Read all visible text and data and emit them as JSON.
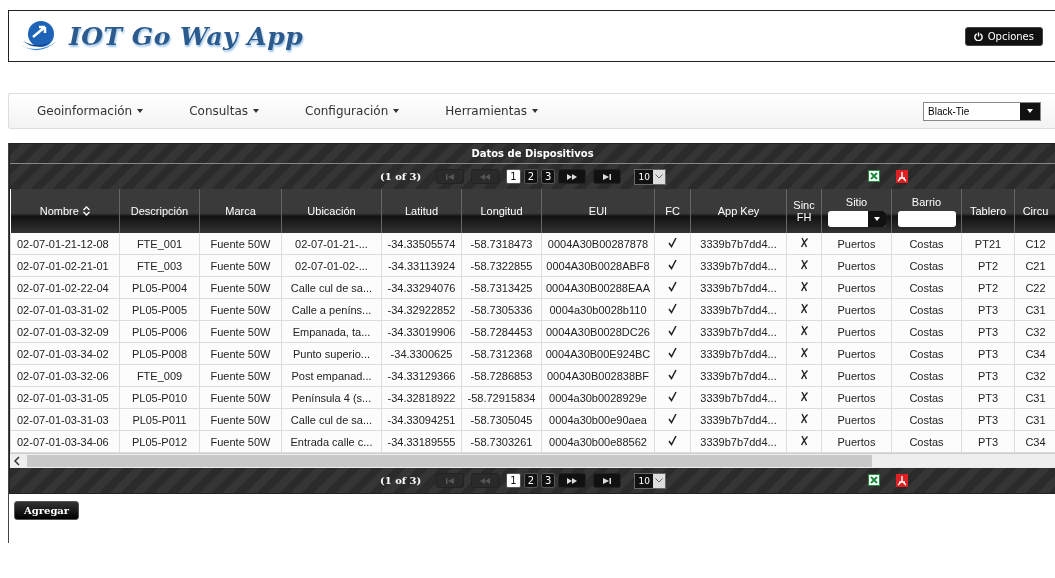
{
  "app": {
    "title": "IOT Go Way App",
    "options_button": "Opciones"
  },
  "menu": [
    {
      "label": "Geoinformación"
    },
    {
      "label": "Consultas"
    },
    {
      "label": "Configuración"
    },
    {
      "label": "Herramientas"
    }
  ],
  "theme_select": {
    "value": "Black-Tie"
  },
  "table": {
    "title": "Datos de Dispositivos",
    "paginators": [
      {
        "status": "(1 of 3)",
        "first": {
          "disabled": true
        },
        "previous": {
          "disabled": true
        },
        "pages": [
          {
            "label": "1",
            "selected": true
          },
          {
            "label": "2",
            "selected": false
          },
          {
            "label": "3",
            "selected": false
          }
        ],
        "next": {
          "disabled": false
        },
        "last": {
          "disabled": false
        },
        "page_size": "10",
        "exports": [
          {
            "kind": "excel"
          },
          {
            "kind": "pdf"
          }
        ]
      },
      {
        "status": "(1 of 3)",
        "first": {
          "disabled": true
        },
        "previous": {
          "disabled": true
        },
        "pages": [
          {
            "label": "1",
            "selected": true
          },
          {
            "label": "2",
            "selected": false
          },
          {
            "label": "3",
            "selected": false
          }
        ],
        "next": {
          "disabled": false
        },
        "last": {
          "disabled": false
        },
        "page_size": "10",
        "exports": [
          {
            "kind": "excel"
          },
          {
            "kind": "pdf"
          }
        ]
      }
    ],
    "columns": [
      {
        "label": "Nombre",
        "sortable": true
      },
      {
        "label": "Descripción"
      },
      {
        "label": "Marca"
      },
      {
        "label": "Ubicación"
      },
      {
        "label": "Latitud"
      },
      {
        "label": "Longitud"
      },
      {
        "label": "EUI"
      },
      {
        "label": "FC"
      },
      {
        "label": "App Key"
      },
      {
        "label": "Sinc FH"
      },
      {
        "label": "Sitio",
        "filter": {
          "kind": "select"
        }
      },
      {
        "label": "Barrio",
        "filter": {
          "kind": "text"
        }
      },
      {
        "label": "Tablero"
      },
      {
        "label": "Circu"
      }
    ],
    "rows": [
      {
        "cells": [
          "02-07-01-21-12-08",
          "FTE_001",
          "Fuente 50W",
          "02-07-01-21-...",
          "-34.33505574",
          "-58.7318473",
          "0004A30B00287878",
          true,
          "3339b7b7dd4...",
          false,
          "Puertos",
          "Costas",
          "PT21",
          "C12"
        ]
      },
      {
        "cells": [
          "02-07-01-02-21-01",
          "FTE_003",
          "Fuente 50W",
          "02-07-01-02-...",
          "-34.33113924",
          "-58.7322855",
          "0004A30B0028ABF8",
          true,
          "3339b7b7dd4...",
          false,
          "Puertos",
          "Costas",
          "PT2",
          "C21"
        ]
      },
      {
        "cells": [
          "02-07-01-02-22-04",
          "PL05-P004",
          "Fuente 50W",
          "Calle cul de sa...",
          "-34.33294076",
          "-58.7313425",
          "0004A30B00288EAA",
          true,
          "3339b7b7dd4...",
          false,
          "Puertos",
          "Costas",
          "PT2",
          "C22"
        ]
      },
      {
        "cells": [
          "02-07-01-03-31-02",
          "PL05-P005",
          "Fuente 50W",
          "Calle a peníns...",
          "-34.32922852",
          "-58.7305336",
          "0004a30b0028b110",
          true,
          "3339b7b7dd4...",
          false,
          "Puertos",
          "Costas",
          "PT3",
          "C31"
        ]
      },
      {
        "cells": [
          "02-07-01-03-32-09",
          "PL05-P006",
          "Fuente 50W",
          "Empanada, ta...",
          "-34.33019906",
          "-58.7284453",
          "0004A30B0028DC26",
          true,
          "3339b7b7dd4...",
          false,
          "Puertos",
          "Costas",
          "PT3",
          "C32"
        ]
      },
      {
        "cells": [
          "02-07-01-03-34-02",
          "PL05-P008",
          "Fuente 50W",
          "Punto superio...",
          "-34.3300625",
          "-58.7312368",
          "0004A30B00E924BC",
          true,
          "3339b7b7dd4...",
          false,
          "Puertos",
          "Costas",
          "PT3",
          "C34"
        ]
      },
      {
        "cells": [
          "02-07-01-03-32-06",
          "FTE_009",
          "Fuente 50W",
          "Post empanad...",
          "-34.33129366",
          "-58.7286853",
          "0004A30B002838BF",
          true,
          "3339b7b7dd4...",
          false,
          "Puertos",
          "Costas",
          "PT3",
          "C32"
        ]
      },
      {
        "cells": [
          "02-07-01-03-31-05",
          "PL05-P010",
          "Fuente 50W",
          "Península 4 (s...",
          "-34.32818922",
          "-58.72915834",
          "0004a30b0028929e",
          true,
          "3339b7b7dd4...",
          false,
          "Puertos",
          "Costas",
          "PT3",
          "C31"
        ]
      },
      {
        "cells": [
          "02-07-01-03-31-03",
          "PL05-P011",
          "Fuente 50W",
          "Calle cul de sa...",
          "-34.33094251",
          "-58.7305045",
          "0004a30b00e90aea",
          true,
          "3339b7b7dd4...",
          false,
          "Puertos",
          "Costas",
          "PT3",
          "C31"
        ]
      },
      {
        "cells": [
          "02-07-01-03-34-06",
          "PL05-P012",
          "Fuente 50W",
          "Entrada calle c...",
          "-34.33189555",
          "-58.7303261",
          "0004a30b00e88562",
          true,
          "3339b7b7dd4...",
          false,
          "Puertos",
          "Costas",
          "PT3",
          "C34"
        ]
      }
    ]
  },
  "add_button": "Agregar"
}
